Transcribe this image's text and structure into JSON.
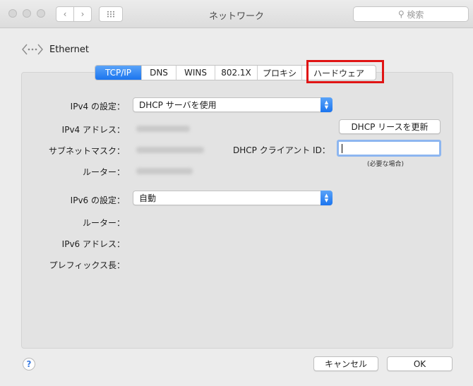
{
  "window": {
    "title": "ネットワーク"
  },
  "toolbar": {
    "search_placeholder": "検索"
  },
  "interface": {
    "name": "Ethernet"
  },
  "tabs": [
    {
      "label": "TCP/IP",
      "active": true
    },
    {
      "label": "DNS",
      "active": false
    },
    {
      "label": "WINS",
      "active": false
    },
    {
      "label": "802.1X",
      "active": false
    },
    {
      "label": "プロキシ",
      "active": false
    },
    {
      "label": "ハードウェア",
      "active": false,
      "highlighted": true
    }
  ],
  "form": {
    "ipv4_config_label": "IPv4 の設定：",
    "ipv4_config_value": "DHCP サーバを使用",
    "ipv4_address_label": "IPv4 アドレス：",
    "subnet_mask_label": "サブネットマスク：",
    "router_label": "ルーター：",
    "renew_button": "DHCP リースを更新",
    "dhcp_client_id_label": "DHCP クライアント ID：",
    "dhcp_client_id_value": "",
    "dhcp_client_id_hint": "(必要な場合)",
    "ipv6_config_label": "IPv6 の設定：",
    "ipv6_config_value": "自動",
    "ipv6_router_label": "ルーター：",
    "ipv6_address_label": "IPv6 アドレス：",
    "prefix_length_label": "プレフィックス長："
  },
  "footer": {
    "help": "?",
    "cancel_button": "キャンセル",
    "ok_button": "OK"
  },
  "colors": {
    "accent": "#1b75ef",
    "highlight_box": "#e01414"
  }
}
